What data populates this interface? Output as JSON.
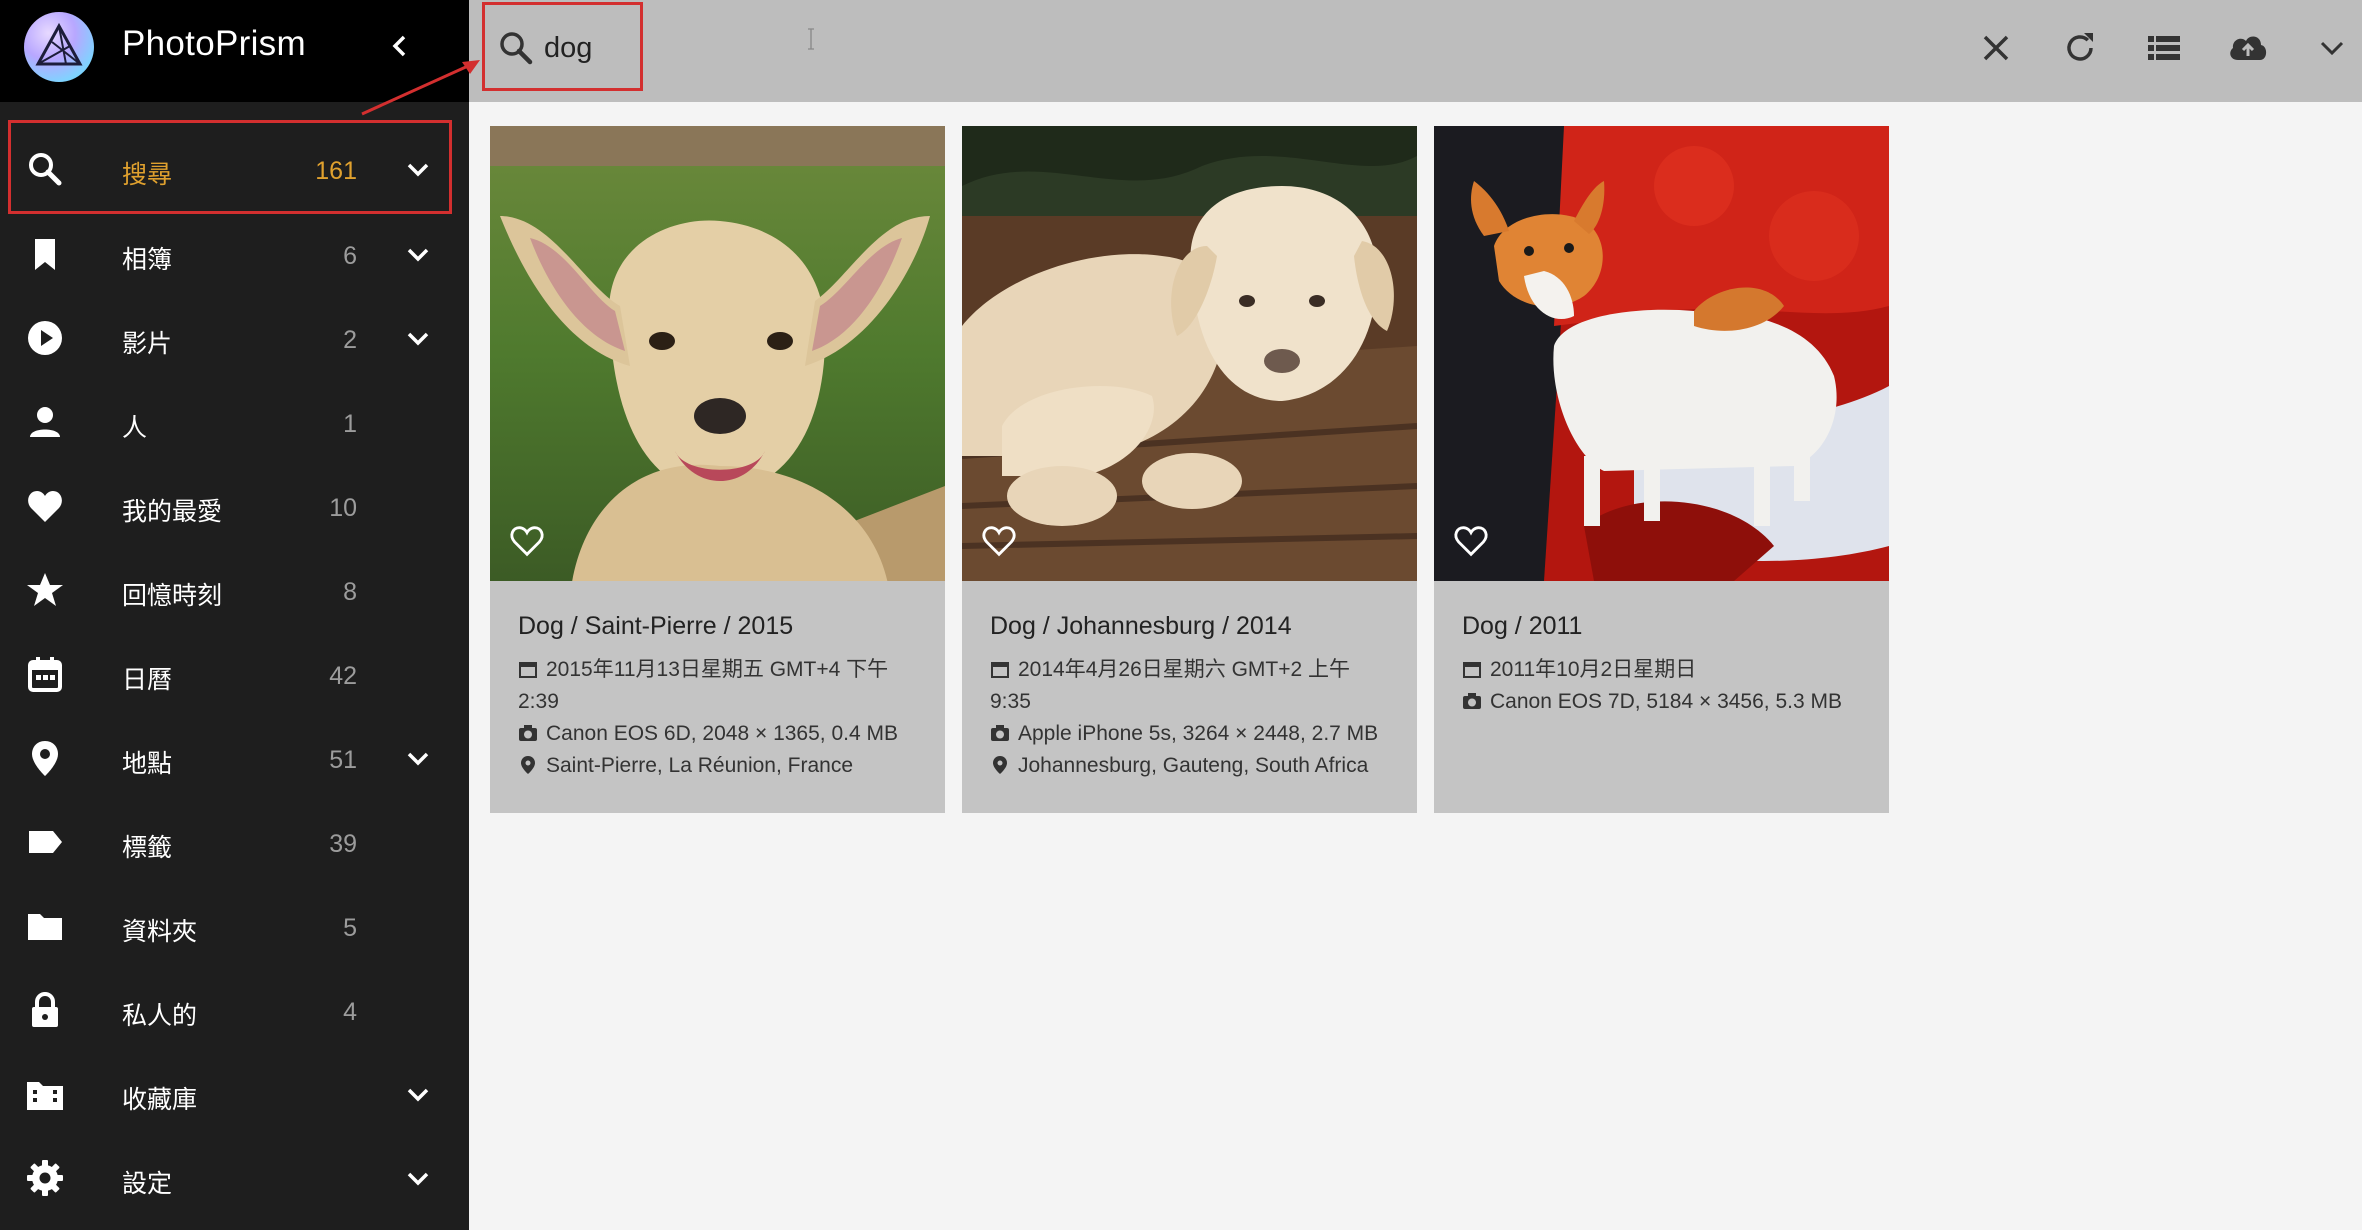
{
  "app": {
    "title": "PhotoPrism"
  },
  "search": {
    "value": "dog"
  },
  "sidebar": {
    "items": [
      {
        "label": "搜尋",
        "count": "161",
        "icon": "search-icon",
        "expandable": true,
        "active": true
      },
      {
        "label": "相簿",
        "count": "6",
        "icon": "bookmark-icon",
        "expandable": true
      },
      {
        "label": "影片",
        "count": "2",
        "icon": "play-circle-icon",
        "expandable": true
      },
      {
        "label": "人",
        "count": "1",
        "icon": "person-icon",
        "expandable": false
      },
      {
        "label": "我的最愛",
        "count": "10",
        "icon": "heart-icon",
        "expandable": false
      },
      {
        "label": "回憶時刻",
        "count": "8",
        "icon": "star-icon",
        "expandable": false
      },
      {
        "label": "日曆",
        "count": "42",
        "icon": "calendar-icon",
        "expandable": false
      },
      {
        "label": "地點",
        "count": "51",
        "icon": "map-marker-icon",
        "expandable": true
      },
      {
        "label": "標籤",
        "count": "39",
        "icon": "label-icon",
        "expandable": false
      },
      {
        "label": "資料夾",
        "count": "5",
        "icon": "folder-icon",
        "expandable": false
      },
      {
        "label": "私人的",
        "count": "4",
        "icon": "lock-icon",
        "expandable": false
      },
      {
        "label": "收藏庫",
        "count": "",
        "icon": "film-folder-icon",
        "expandable": true
      },
      {
        "label": "設定",
        "count": "",
        "icon": "gear-icon",
        "expandable": true
      }
    ]
  },
  "toolbar": {
    "icons": [
      "close-icon",
      "refresh-icon",
      "list-view-icon",
      "cloud-upload-icon",
      "chevron-down-icon"
    ]
  },
  "photos": [
    {
      "title": "Dog / Saint-Pierre / 2015",
      "date_line1": "2015年11月13日星期五 GMT+4 下午",
      "date_line2": "2:39",
      "camera": "Canon EOS 6D, 2048 × 1365, 0.4 MB",
      "location": "Saint-Pierre, La Réunion, France"
    },
    {
      "title": "Dog / Johannesburg / 2014",
      "date_line1": "2014年4月26日星期六 GMT+2 上午",
      "date_line2": "9:35",
      "camera": "Apple iPhone 5s, 3264 × 2448, 2.7 MB",
      "location": "Johannesburg, Gauteng, South Africa"
    },
    {
      "title": "Dog / 2011",
      "date_line1": "2011年10月2日星期日",
      "date_line2": "",
      "camera": "Canon EOS 7D, 5184 × 3456, 5.3 MB",
      "location": ""
    }
  ],
  "colors": {
    "accent": "#e0a12e",
    "highlight_box": "#d32f2f",
    "sidebar_bg": "#1e1e1e",
    "toolbar_bg": "#bdbdbd"
  }
}
